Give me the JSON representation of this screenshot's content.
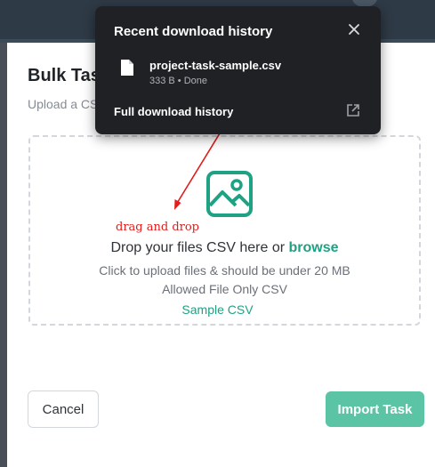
{
  "modal": {
    "title": "Bulk Task",
    "subtitle": "Upload a CSV"
  },
  "dropzone": {
    "icon": "image-icon",
    "drop_text": "Drop your files CSV here or",
    "browse_label": "browse",
    "hint_size": "Click to upload files & should be under 20 MB",
    "hint_type": "Allowed File Only CSV"
  },
  "sample_link": "Sample CSV",
  "buttons": {
    "cancel": "Cancel",
    "import": "Import Task"
  },
  "annotation": {
    "text": "drag and drop",
    "color": "#e11d1d"
  },
  "download_popup": {
    "title": "Recent download history",
    "close_icon": "close-icon",
    "file_icon": "file-icon",
    "file_name": "project-task-sample.csv",
    "file_meta": "333 B • Done",
    "full_history_label": "Full download history",
    "open_icon": "open-external-icon"
  },
  "colors": {
    "accent": "#1ea283",
    "import_button": "#5bc4a5",
    "topbar": "#2e3a46",
    "popup_bg": "#1f2125"
  }
}
